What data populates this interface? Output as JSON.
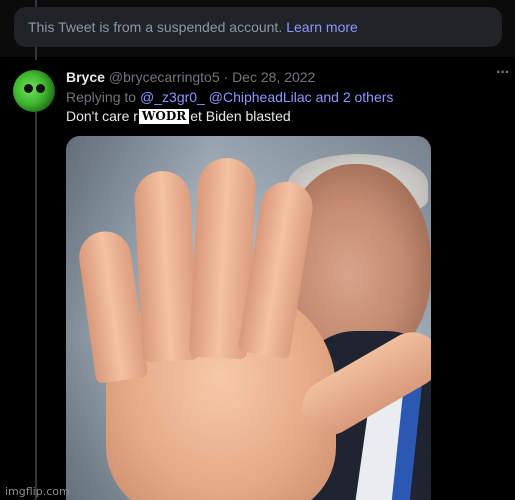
{
  "suspended_notice": {
    "message": "This Tweet is from a suspended account.",
    "learn_more": "Learn more"
  },
  "tweet": {
    "display_name": "Bryce",
    "handle_date": "@brycecarringto5 · Dec 28, 2022",
    "replying_prefix": "Replying to",
    "replying_targets": "@_z3gr0_ @ChipheadLilac and 2 others",
    "text_before": "Don't care r",
    "censor_label": "WODR",
    "text_after": "et Biden blasted",
    "more_icon": "more-horizontal-icon"
  },
  "media": {
    "alt_description": "photo"
  },
  "watermark": "imgflip.com",
  "colors": {
    "background": "#000000",
    "card": "#202327",
    "link": "#8f97ff",
    "muted": "#71767b",
    "text": "#e7e9ea"
  }
}
